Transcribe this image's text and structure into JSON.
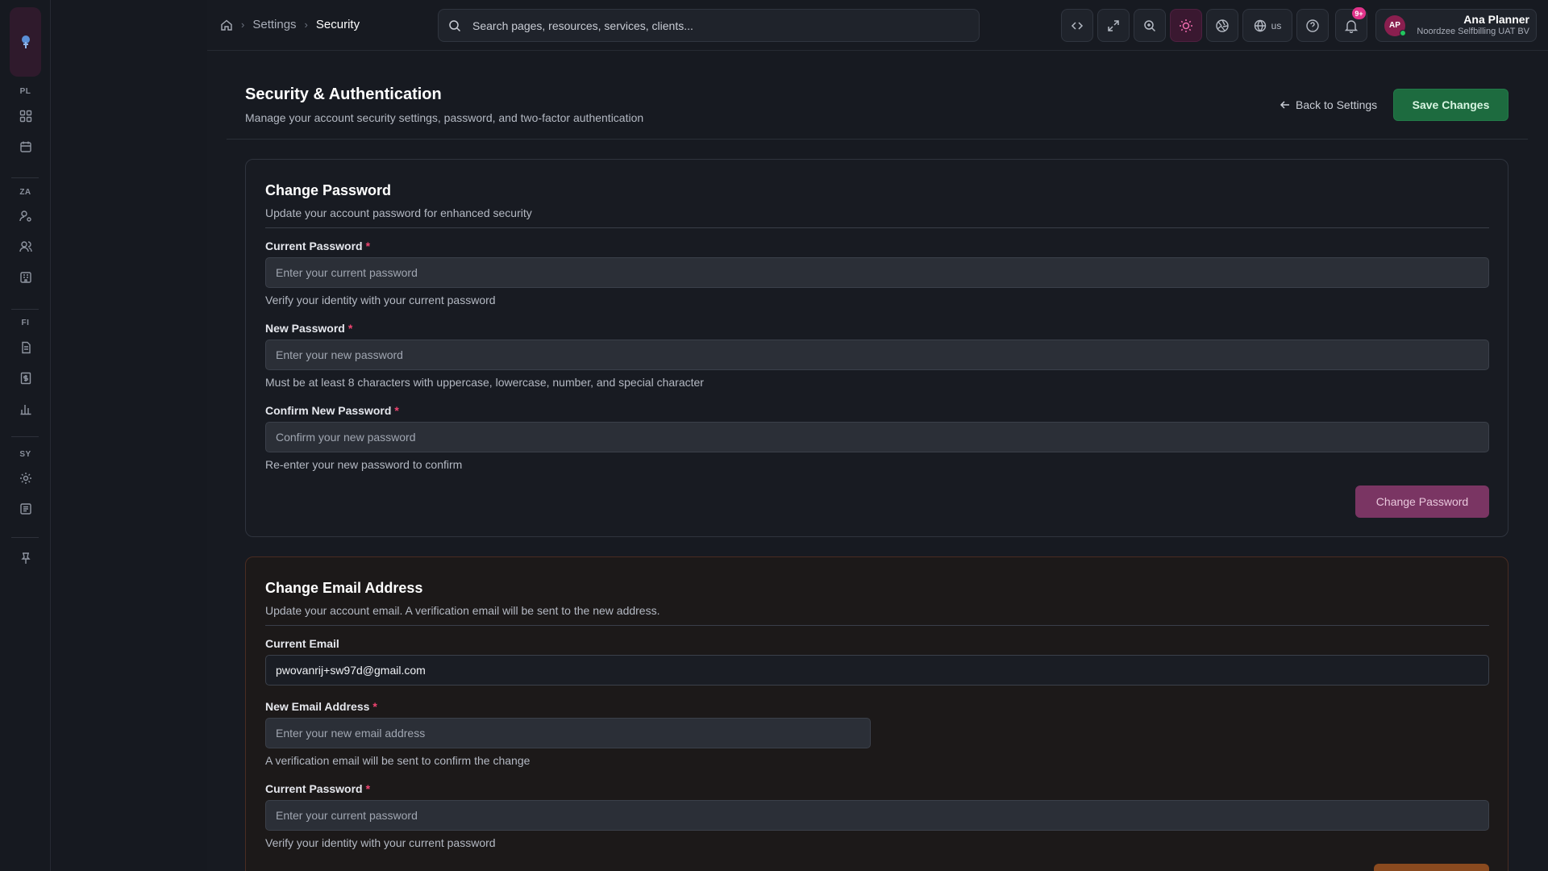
{
  "rail": {
    "sections": [
      "PL",
      "ZA",
      "FI",
      "SY"
    ],
    "icons": [
      "grid-icon",
      "calendar-icon",
      "user-settings-icon",
      "users-icon",
      "building-icon",
      "document-icon",
      "invoice-icon",
      "bar-chart-icon",
      "settings-gear-icon",
      "ledger-icon",
      "pin-icon"
    ]
  },
  "breadcrumb": {
    "home_icon": "home-icon",
    "items": [
      "Settings",
      "Security"
    ]
  },
  "search": {
    "placeholder": "Search pages, resources, services, clients..."
  },
  "toolbar": {
    "locale": "us",
    "notification_count": "9+",
    "accent": "#f06cae"
  },
  "user": {
    "initials": "AP",
    "name": "Ana Planner",
    "org": "Noordzee Selfbilling UAT BV"
  },
  "page": {
    "title": "Security & Authentication",
    "subtitle": "Manage your account security settings, password, and two-factor authentication",
    "back_label": "Back to Settings",
    "save_label": "Save Changes"
  },
  "password_card": {
    "title": "Change Password",
    "subtitle": "Update your account password for enhanced security",
    "current_label": "Current Password",
    "current_placeholder": "Enter your current password",
    "current_help": "Verify your identity with your current password",
    "new_label": "New Password",
    "new_placeholder": "Enter your new password",
    "new_help": "Must be at least 8 characters with uppercase, lowercase, number, and special character",
    "confirm_label": "Confirm New Password",
    "confirm_placeholder": "Confirm your new password",
    "confirm_help": "Re-enter your new password to confirm",
    "button_label": "Change Password",
    "required_mark": "*"
  },
  "email_card": {
    "title": "Change Email Address",
    "subtitle": "Update your account email. A verification email will be sent to the new address.",
    "current_email_label": "Current Email",
    "current_email_value": "pwovanrij+sw97d@gmail.com",
    "new_email_label": "New Email Address",
    "new_email_placeholder": "Enter your new email address",
    "new_email_help": "A verification email will be sent to confirm the change",
    "password_label": "Current Password",
    "password_placeholder": "Enter your current password",
    "password_help": "Verify your identity with your current password",
    "required_mark": "*"
  }
}
